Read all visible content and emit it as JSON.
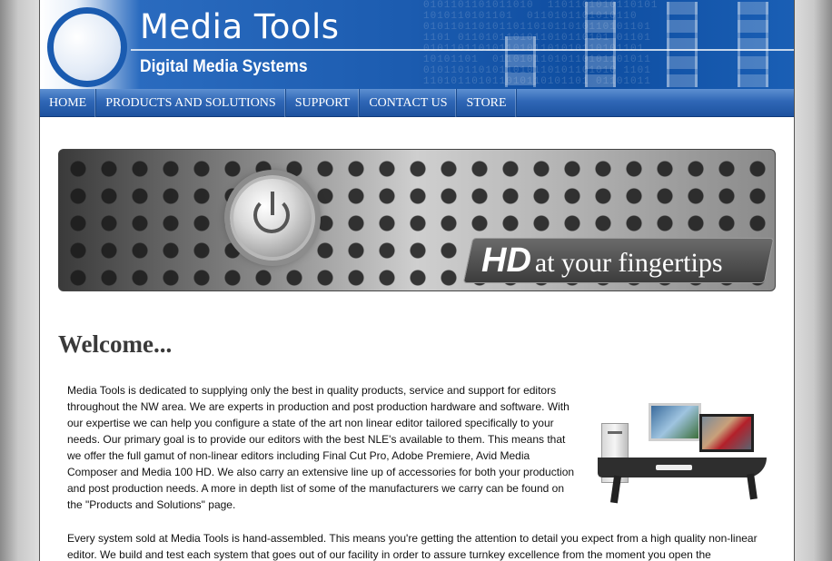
{
  "banner": {
    "title": "Media Tools",
    "subtitle": "Digital Media Systems"
  },
  "nav": {
    "items": [
      {
        "label": "HOME"
      },
      {
        "label": "PRODUCTS AND SOLUTIONS"
      },
      {
        "label": "SUPPORT"
      },
      {
        "label": "CONTACT US"
      },
      {
        "label": "STORE"
      }
    ]
  },
  "hero": {
    "hd": "HD",
    "tagline": "at your fingertips"
  },
  "main": {
    "heading": "Welcome...",
    "paragraph1": "Media Tools is dedicated to supplying only the best in quality products, service and support for editors throughout the NW area. We are experts in production and post production hardware and software. With our expertise we can help you configure a state of the art non linear editor tailored specifically to your needs. Our primary goal is to provide our editors with the best NLE's available to them. This means that we offer the full gamut of non-linear editors including Final Cut Pro, Adobe Premiere, Avid Media Composer and Media 100 HD. We also carry an extensive line up of accessories for both your production and post production needs. A more in depth list of some of the manufacturers we carry can be found on the \"Products and Solutions\" page.",
    "paragraph2": "Every system sold at Media Tools is hand-assembled. This means you're getting the attention to detail you expect from a high quality non-linear editor. We build and test each system that goes out of our facility in order to assure turnkey excellence from the moment you open the"
  },
  "colors": {
    "brand_blue": "#1c5cb0",
    "nav_top": "#5d8fd1",
    "nav_bottom": "#1d529f"
  }
}
